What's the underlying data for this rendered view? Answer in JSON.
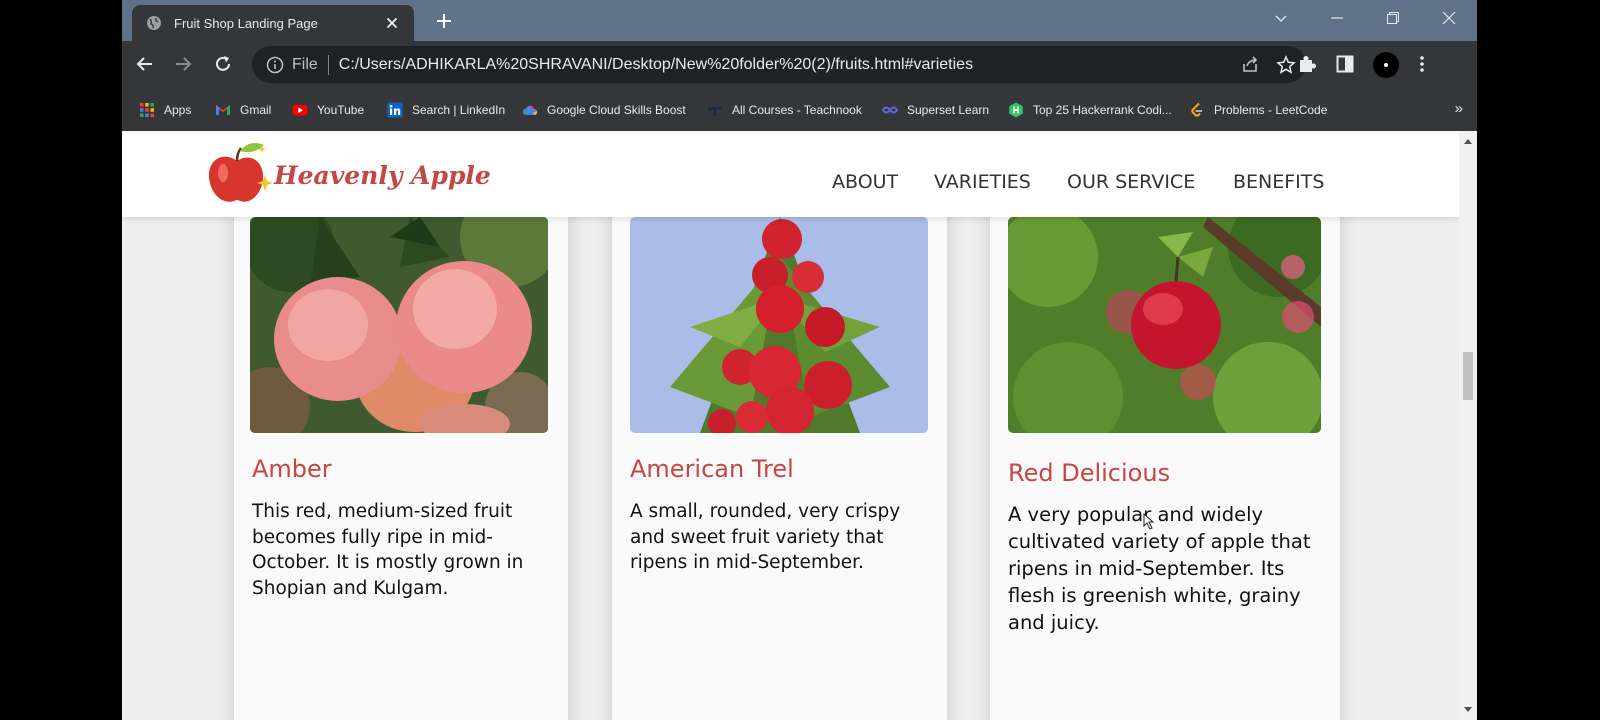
{
  "browser": {
    "tab": {
      "title": "Fruit Shop Landing Page"
    },
    "address": {
      "scheme_label": "File",
      "url": "C:/Users/ADHIKARLA%20SHRAVANI/Desktop/New%20folder%20(2)/fruits.html#varieties"
    },
    "bookmarks": [
      {
        "label": "Apps",
        "icon": "apps-grid-icon"
      },
      {
        "label": "Gmail",
        "icon": "gmail-icon"
      },
      {
        "label": "YouTube",
        "icon": "youtube-icon"
      },
      {
        "label": "Search | LinkedIn",
        "icon": "linkedin-icon"
      },
      {
        "label": "Google Cloud Skills Boost",
        "icon": "google-cloud-icon"
      },
      {
        "label": "All Courses - Teachnook",
        "icon": "teachnook-icon"
      },
      {
        "label": "Superset Learn",
        "icon": "superset-icon"
      },
      {
        "label": "Top 25 Hackerrank Codi...",
        "icon": "hackerrank-icon"
      },
      {
        "label": "Problems - LeetCode",
        "icon": "leetcode-icon"
      }
    ],
    "bookmarks_overflow": "»"
  },
  "site": {
    "logo_text": "Heavenly Apple",
    "nav": [
      "ABOUT",
      "VARIETIES",
      "OUR SERVICE",
      "BENEFITS"
    ],
    "brand_color": "#c64545"
  },
  "varieties": [
    {
      "name": "Amber",
      "description": "This red, medium-sized fruit becomes fully ripe in mid-October. It is mostly grown in Shopian and Kulgam."
    },
    {
      "name": "American Trel",
      "description": "A small, rounded, very crispy and sweet fruit variety that ripens in mid-September."
    },
    {
      "name": "Red Delicious",
      "description": "A very popular and widely cultivated variety of apple that ripens in mid-September. Its flesh is greenish white, grainy and juicy."
    }
  ]
}
